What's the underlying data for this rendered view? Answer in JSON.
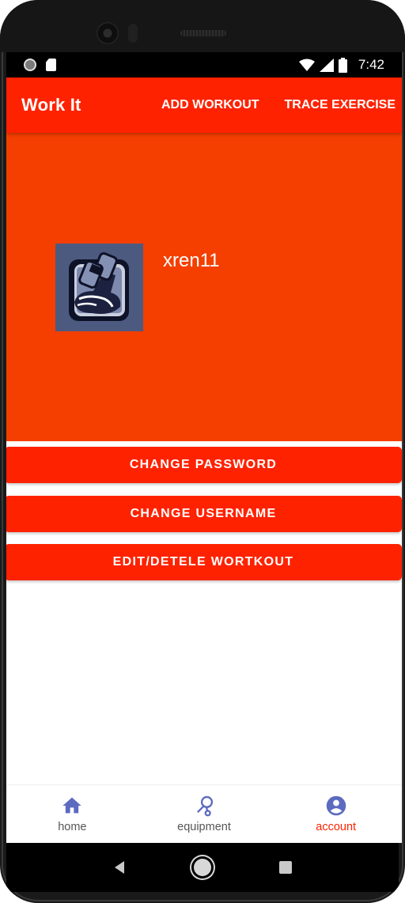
{
  "status_bar": {
    "time": "7:42",
    "icons": [
      "notification-dot-icon",
      "sd-card-icon",
      "wifi-icon",
      "cell-signal-icon",
      "battery-icon"
    ]
  },
  "app_bar": {
    "title": "Work It",
    "actions": [
      {
        "label": "ADD WORKOUT"
      },
      {
        "label": "TRACE EXERCISE"
      }
    ]
  },
  "profile": {
    "username": "xren11",
    "avatar_icon": "flexed-arm-dumbbell-icon"
  },
  "buttons": [
    {
      "label": "CHANGE PASSWORD"
    },
    {
      "label": "CHANGE USERNAME"
    },
    {
      "label": "EDIT/DETELE WORTKOUT"
    }
  ],
  "bottom_nav": {
    "active": "account",
    "items": [
      {
        "label": "home",
        "icon": "home-icon"
      },
      {
        "label": "equipment",
        "icon": "jump-rope-icon"
      },
      {
        "label": "account",
        "icon": "account-circle-icon"
      }
    ]
  },
  "system_nav": {
    "icons": [
      "back-icon",
      "home-circle-icon",
      "recent-apps-icon"
    ]
  },
  "colors": {
    "primary": "#ff2200",
    "profile_background": "#f43f00",
    "nav_icon": "#5c6bc0",
    "active_label": "#ff2200",
    "avatar_background": "#4d5a80"
  }
}
